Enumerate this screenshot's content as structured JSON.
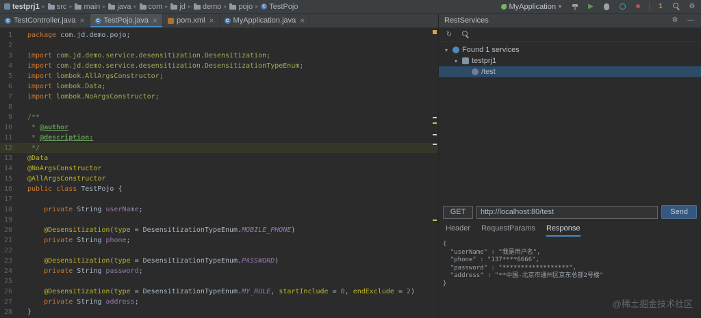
{
  "icons": {
    "chevron_down": "▾",
    "run": "▶",
    "stop": "■",
    "gear": "⚙",
    "refresh": "↻",
    "minimize": "—",
    "close": "×",
    "breadcrumb_sep": "▸",
    "expand": "▾"
  },
  "colors": {
    "accent_blue": "#4a88c7",
    "send_button": "#365880",
    "stop_red": "#c75450",
    "warning_yellow": "#d9a343",
    "selection_blue": "#2d4a66"
  },
  "breadcrumb": {
    "items": [
      {
        "label": "testprj1",
        "icon": "project"
      },
      {
        "label": "src",
        "icon": "folder"
      },
      {
        "label": "main",
        "icon": "folder"
      },
      {
        "label": "java",
        "icon": "folder"
      },
      {
        "label": "com",
        "icon": "folder"
      },
      {
        "label": "jd",
        "icon": "folder"
      },
      {
        "label": "demo",
        "icon": "folder"
      },
      {
        "label": "pojo",
        "icon": "folder"
      },
      {
        "label": "TestPojo",
        "icon": "class"
      }
    ]
  },
  "toolbar": {
    "run_config": "MyApplication",
    "notification_count": "1"
  },
  "tabs": [
    {
      "label": "TestController.java",
      "type": "class",
      "active": false
    },
    {
      "label": "TestPojo.java",
      "type": "class",
      "active": true
    },
    {
      "label": "pom.xml",
      "type": "xml",
      "active": false
    },
    {
      "label": "MyApplication.java",
      "type": "class",
      "active": false
    }
  ],
  "editor": {
    "caret_line": 12,
    "lines": [
      [
        [
          "kw",
          "package"
        ],
        [
          "pl",
          " com.jd.demo.pojo;"
        ]
      ],
      [],
      [
        [
          "kw",
          "import"
        ],
        [
          "imp",
          " com.jd.demo.service.desensitization.Desensitization;"
        ]
      ],
      [
        [
          "kw",
          "import"
        ],
        [
          "imp",
          " com.jd.demo.service.desensitization.DesensitizationTypeEnum;"
        ]
      ],
      [
        [
          "kw",
          "import"
        ],
        [
          "imp",
          " lombok.AllArgsConstructor;"
        ]
      ],
      [
        [
          "kw",
          "import"
        ],
        [
          "imp",
          " lombok.Data;"
        ]
      ],
      [
        [
          "kw",
          "import"
        ],
        [
          "imp",
          " lombok.NoArgsConstructor;"
        ]
      ],
      [],
      [
        [
          "doc",
          "/**"
        ]
      ],
      [
        [
          "doc",
          " * "
        ],
        [
          "doctag",
          "@author"
        ]
      ],
      [
        [
          "doc",
          " * "
        ],
        [
          "doctag",
          "@description:"
        ]
      ],
      [
        [
          "doc",
          " */"
        ]
      ],
      [
        [
          "ann",
          "@Data"
        ]
      ],
      [
        [
          "ann",
          "@NoArgsConstructor"
        ]
      ],
      [
        [
          "ann",
          "@AllArgsConstructor"
        ]
      ],
      [
        [
          "kw",
          "public class"
        ],
        [
          "pl",
          " TestPojo {"
        ]
      ],
      [],
      [
        [
          "pl",
          "    "
        ],
        [
          "kw",
          "private"
        ],
        [
          "pl",
          " String "
        ],
        [
          "field",
          "userName"
        ],
        [
          "pl",
          ";"
        ]
      ],
      [],
      [
        [
          "pl",
          "    "
        ],
        [
          "ann",
          "@Desensitization"
        ],
        [
          "pl",
          "("
        ],
        [
          "ann",
          "type"
        ],
        [
          "pl",
          " = DesensitizationTypeEnum."
        ],
        [
          "const",
          "MOBILE_PHONE"
        ],
        [
          "pl",
          ")"
        ]
      ],
      [
        [
          "pl",
          "    "
        ],
        [
          "kw",
          "private"
        ],
        [
          "pl",
          " String "
        ],
        [
          "field",
          "phone"
        ],
        [
          "pl",
          ";"
        ]
      ],
      [],
      [
        [
          "pl",
          "    "
        ],
        [
          "ann",
          "@Desensitization"
        ],
        [
          "pl",
          "("
        ],
        [
          "ann",
          "type"
        ],
        [
          "pl",
          " = DesensitizationTypeEnum."
        ],
        [
          "const",
          "PASSWORD"
        ],
        [
          "pl",
          ")"
        ]
      ],
      [
        [
          "pl",
          "    "
        ],
        [
          "kw",
          "private"
        ],
        [
          "pl",
          " String "
        ],
        [
          "field",
          "password"
        ],
        [
          "pl",
          ";"
        ]
      ],
      [],
      [
        [
          "pl",
          "    "
        ],
        [
          "ann",
          "@Desensitization"
        ],
        [
          "pl",
          "("
        ],
        [
          "ann",
          "type"
        ],
        [
          "pl",
          " = DesensitizationTypeEnum."
        ],
        [
          "const",
          "MY_RULE"
        ],
        [
          "pl",
          ", "
        ],
        [
          "ann",
          "startInclude"
        ],
        [
          "pl",
          " = "
        ],
        [
          "num",
          "0"
        ],
        [
          "pl",
          ", "
        ],
        [
          "ann",
          "endExclude"
        ],
        [
          "pl",
          " = "
        ],
        [
          "num",
          "2"
        ],
        [
          "pl",
          ")"
        ]
      ],
      [
        [
          "pl",
          "    "
        ],
        [
          "kw",
          "private"
        ],
        [
          "pl",
          " String "
        ],
        [
          "field",
          "address"
        ],
        [
          "pl",
          ";"
        ]
      ],
      [
        [
          "pl",
          "}"
        ]
      ]
    ]
  },
  "rest_panel": {
    "title": "RestServices",
    "tree": [
      {
        "label": "Found 1 services",
        "depth": 0,
        "icon": "services",
        "expandable": true,
        "selected": false
      },
      {
        "label": "testprj1",
        "depth": 1,
        "icon": "module",
        "expandable": true,
        "selected": false
      },
      {
        "label": "/test",
        "depth": 2,
        "icon": "endpoint",
        "expandable": false,
        "selected": true
      }
    ],
    "request": {
      "method": "GET",
      "url": "http://localhost:80/test",
      "send_label": "Send"
    },
    "tabs": [
      {
        "label": "Header",
        "active": false
      },
      {
        "label": "RequestParams",
        "active": false
      },
      {
        "label": "Response",
        "active": true
      }
    ],
    "response_lines": [
      "{",
      "  \"userName\" : \"我是用户名\",",
      "  \"phone\" : \"137****6666\",",
      "  \"password\" : \"******************\",",
      "  \"address\" : \"**中国-北京市通州区京东总部2号楼\"",
      "}"
    ]
  },
  "watermark": "@稀土掘金技术社区"
}
